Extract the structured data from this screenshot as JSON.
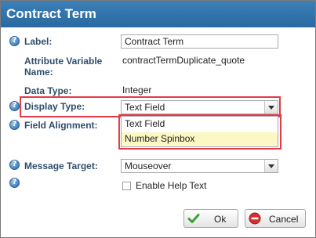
{
  "dialog": {
    "title": "Contract Term"
  },
  "fields": {
    "label": {
      "label": "Label:",
      "value": "Contract Term"
    },
    "attribute_variable": {
      "label_line1": "Attribute Variable",
      "label_line2": "Name:",
      "value": "contractTermDuplicate_quote"
    },
    "data_type": {
      "label": "Data Type:",
      "value": "Integer"
    },
    "display_type": {
      "label": "Display Type:",
      "selected": "Text Field",
      "options": [
        "Text Field",
        "Number Spinbox"
      ]
    },
    "field_alignment": {
      "label": "Field Alignment:"
    },
    "message_target": {
      "label": "Message Target:",
      "selected": "Mouseover"
    },
    "help_text": {
      "label": "Enable Help Text",
      "checked": false
    }
  },
  "buttons": {
    "ok": "Ok",
    "cancel": "Cancel"
  },
  "colors": {
    "title_bar": "#2f74ad",
    "highlight_box": "#e33b48",
    "hover_option": "#fbf8c4",
    "label_text": "#2f4d6b"
  }
}
